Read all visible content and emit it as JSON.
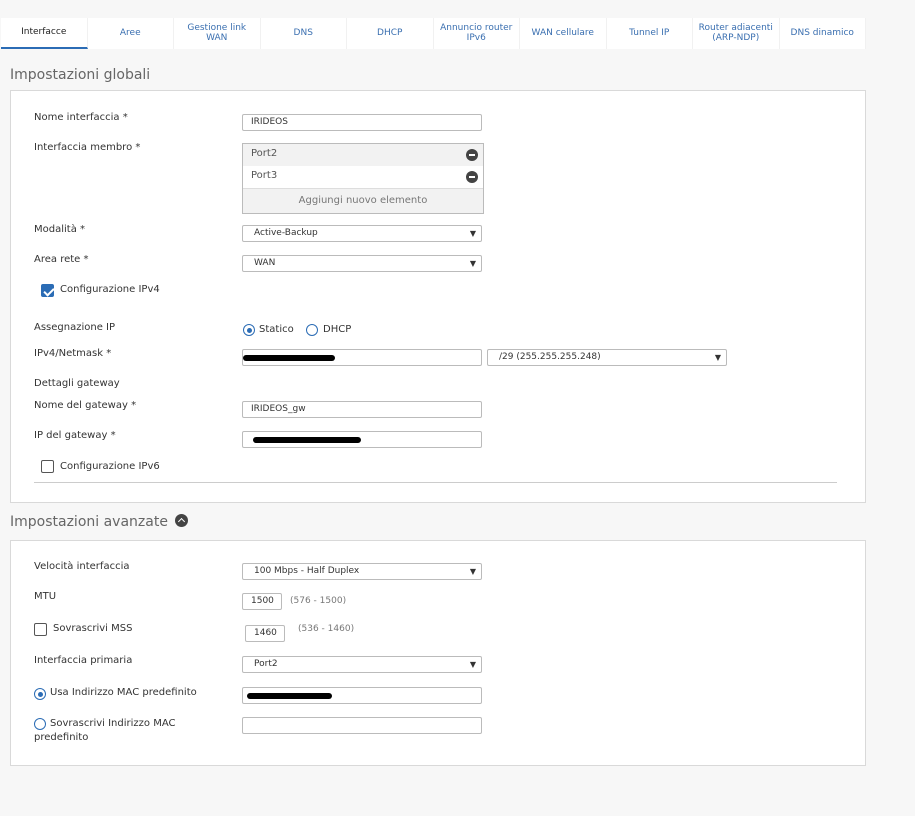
{
  "tabs": [
    {
      "label": "Interfacce",
      "active": true
    },
    {
      "label": "Aree"
    },
    {
      "label": "Gestione link WAN"
    },
    {
      "label": "DNS"
    },
    {
      "label": "DHCP"
    },
    {
      "label": "Annuncio router IPv6"
    },
    {
      "label": "WAN cellulare"
    },
    {
      "label": "Tunnel IP"
    },
    {
      "label": "Router adiacenti (ARP-NDP)"
    },
    {
      "label": "DNS dinamico"
    }
  ],
  "global": {
    "title": "Impostazioni globali",
    "name_label": "Nome interfaccia *",
    "name_value": "IRIDEOS",
    "member_label": "Interfaccia membro *",
    "members": [
      "Port2",
      "Port3"
    ],
    "add_member_label": "Aggiungi nuovo elemento",
    "mode_label": "Modalità *",
    "mode_value": "Active-Backup",
    "zone_label": "Area rete *",
    "zone_value": "WAN",
    "ipv4_config_label": "Configurazione IPv4",
    "ipv4_config_checked": true,
    "ip_assign_label": "Assegnazione IP",
    "static_label": "Statico",
    "dhcp_label": "DHCP",
    "ip_assign_selected": "Statico",
    "ipv4_label": "IPv4/Netmask *",
    "netmask_value": "/29 (255.255.255.248)",
    "gateway_details_label": "Dettagli gateway",
    "gw_name_label": "Nome del gateway *",
    "gw_name_value": "IRIDEOS_gw",
    "gw_ip_label": "IP del gateway *",
    "ipv6_config_label": "Configurazione IPv6",
    "ipv6_config_checked": false
  },
  "advanced": {
    "title": "Impostazioni avanzate",
    "speed_label": "Velocità interfaccia",
    "speed_value": "100 Mbps - Half Duplex",
    "mtu_label": "MTU",
    "mtu_value": "1500",
    "mtu_range": "(576 - 1500)",
    "mss_label": "Sovrascrivi MSS",
    "mss_checked": false,
    "mss_value": "1460",
    "mss_range": "(536 - 1460)",
    "primary_label": "Interfaccia primaria",
    "primary_value": "Port2",
    "default_mac_label": "Usa Indirizzo MAC predefinito",
    "override_mac_label": "Sovrascrivi Indirizzo MAC predefinito",
    "mac_selected": "default"
  },
  "colors": {
    "accent": "#2b6cb5",
    "tab_text": "#3a6fb0",
    "background": "#f7f7f7"
  },
  "icons": {
    "remove": "minus-circle-icon",
    "collapse": "chevron-up-icon",
    "dropdown": "caret-down-icon"
  }
}
